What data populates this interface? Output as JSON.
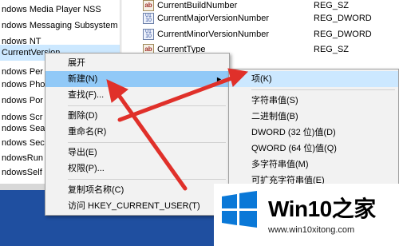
{
  "tree": {
    "items": [
      {
        "label": "ndows Media Player NSS",
        "selected": false
      },
      {
        "label": "ndows Messaging Subsystem",
        "selected": false
      },
      {
        "label": "ndows NT",
        "selected": false
      },
      {
        "label": "CurrentVersion",
        "selected": true
      },
      {
        "label": "ndows Per",
        "selected": false
      },
      {
        "label": "ndows Pho",
        "selected": false
      },
      {
        "label": "ndows Por",
        "selected": false
      },
      {
        "label": "ndows Scr",
        "selected": false
      },
      {
        "label": "ndows Sea",
        "selected": false
      },
      {
        "label": "ndows Sec",
        "selected": false
      },
      {
        "label": "ndowsRun",
        "selected": false
      },
      {
        "label": "ndowsSelf",
        "selected": false
      }
    ]
  },
  "values": {
    "rows": [
      {
        "name": "CurrentBuildNumber",
        "type": "REG_SZ",
        "icon": "string-value-icon"
      },
      {
        "name": "CurrentMajorVersionNumber",
        "type": "REG_DWORD",
        "icon": "binary-value-icon"
      },
      {
        "name": "CurrentMinorVersionNumber",
        "type": "REG_DWORD",
        "icon": "binary-value-icon"
      },
      {
        "name": "CurrentType",
        "type": "REG_SZ",
        "icon": "string-value-icon"
      }
    ]
  },
  "context_menu": {
    "items": [
      {
        "label": "展开"
      },
      {
        "label": "新建(N)",
        "has_submenu": true
      },
      {
        "label": "查找(F)..."
      },
      {
        "label": "删除(D)"
      },
      {
        "label": "重命名(R)"
      },
      {
        "label": "导出(E)"
      },
      {
        "label": "权限(P)..."
      },
      {
        "label": "复制项名称(C)"
      },
      {
        "label": "访问 HKEY_CURRENT_USER(T)"
      }
    ]
  },
  "submenu": {
    "items": [
      {
        "label": "项(K)"
      },
      {
        "label": "字符串值(S)"
      },
      {
        "label": "二进制值(B)"
      },
      {
        "label": "DWORD (32 位)值(D)"
      },
      {
        "label": "QWORD (64 位)值(Q)"
      },
      {
        "label": "多字符串值(M)"
      },
      {
        "label": "可扩充字符串值(E)"
      }
    ]
  },
  "logo": {
    "title": "Win10",
    "title_suffix": "之家",
    "url": "www.win10xitong.com"
  },
  "colors": {
    "menu_hover": "#91c9f7",
    "tree_selected": "#cce8ff",
    "arrow": "#e0302a",
    "win_logo": "#0a78d7",
    "taskbar": "#1f4fa0"
  }
}
